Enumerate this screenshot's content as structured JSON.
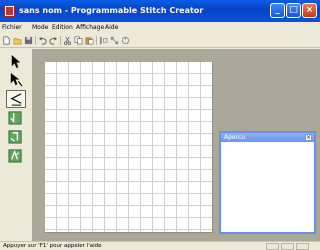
{
  "window": {
    "title": "sans nom - Programmable Stitch Creator"
  },
  "title_buttons": {
    "minimize": "_",
    "maximize": "□",
    "close": "×"
  },
  "menu": [
    {
      "label": "Fichier"
    },
    {
      "label": "Mode"
    },
    {
      "label": "Edition"
    },
    {
      "label": "Affichage"
    },
    {
      "label": "Aide"
    }
  ],
  "toolbar": {
    "icons": [
      "new-icon",
      "open-icon",
      "save-icon",
      "undo-icon",
      "redo-icon",
      "cut-icon",
      "copy-icon",
      "paste-icon",
      "icon-9",
      "icon-10",
      "icon-11"
    ]
  },
  "tools": {
    "icons": [
      "select-arrow-icon",
      "point-arrow-icon",
      "stitch-line-icon",
      "pattern-1-icon",
      "pattern-2-icon",
      "pattern-3-icon"
    ],
    "selected": "stitch-line-icon"
  },
  "preview": {
    "title": "Apercu",
    "close": "×"
  },
  "status": {
    "text": "Appuyer sur 'F1' pour appeler l'aide"
  }
}
